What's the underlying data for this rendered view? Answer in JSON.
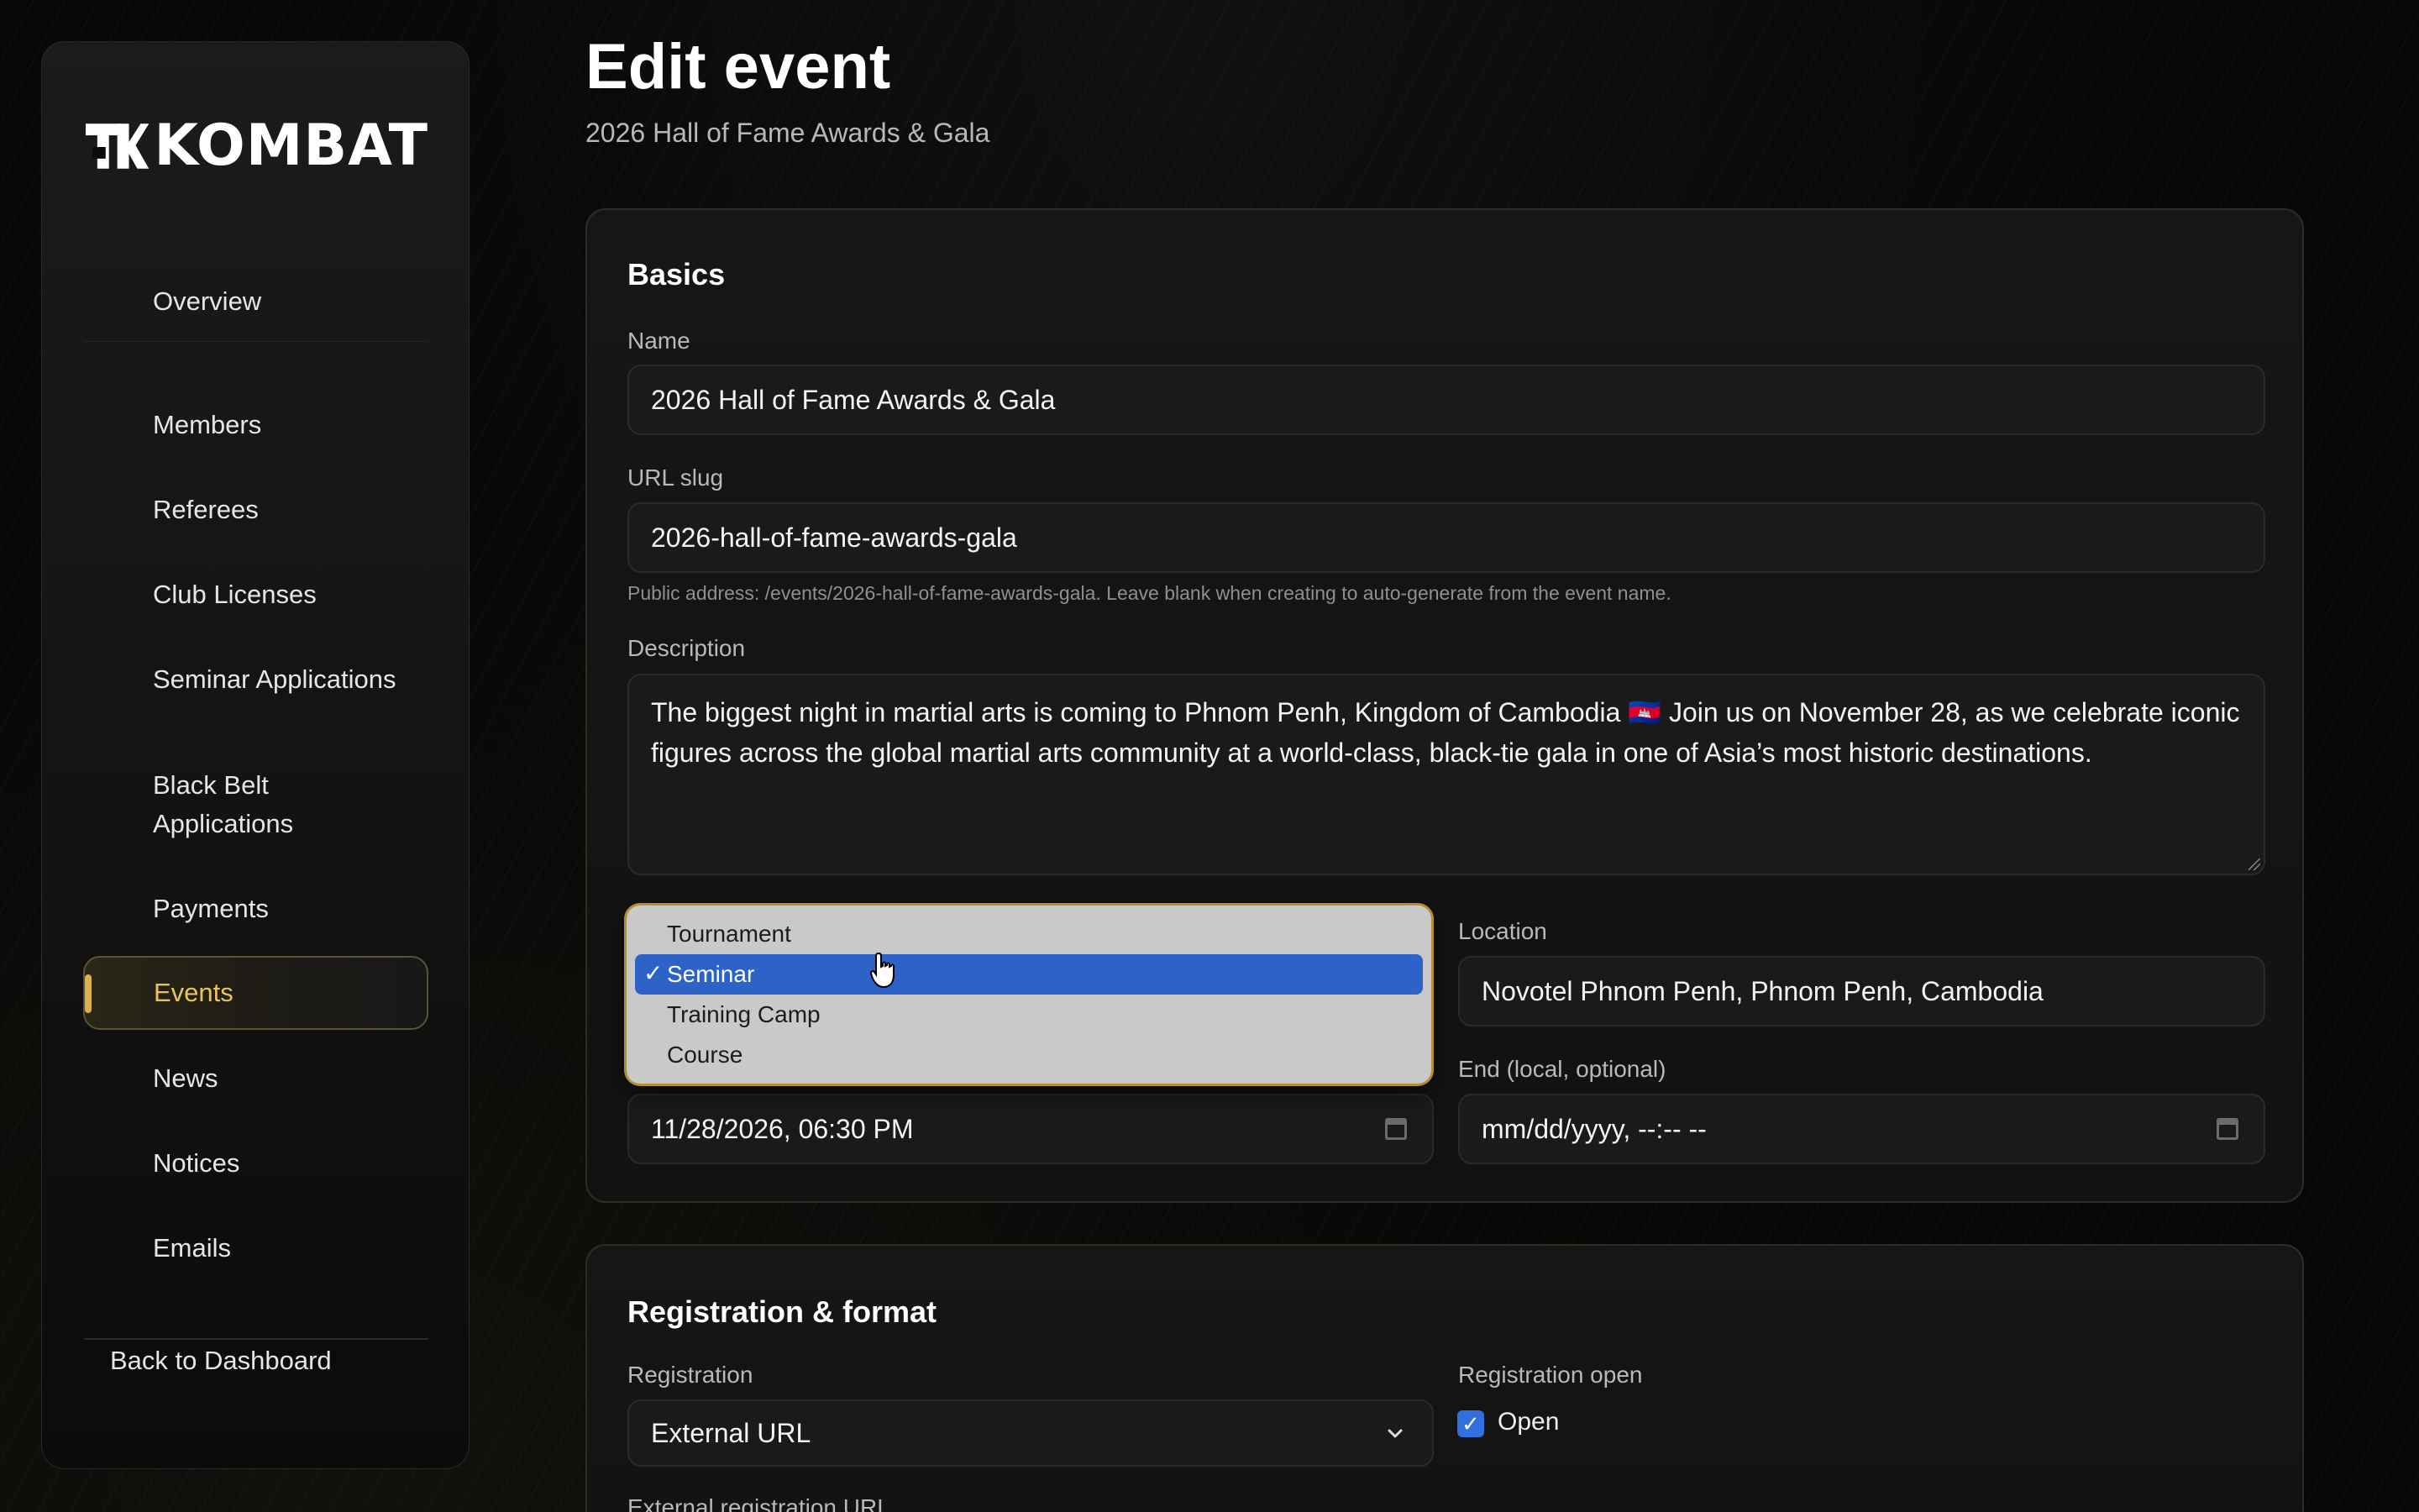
{
  "brand": {
    "name": "KOMBAT"
  },
  "sidebar": {
    "items": [
      {
        "label": "Overview"
      },
      {
        "label": "Members"
      },
      {
        "label": "Referees"
      },
      {
        "label": "Club Licenses"
      },
      {
        "label": "Seminar Applications"
      },
      {
        "label": "Black Belt Applications"
      },
      {
        "label": "Payments"
      },
      {
        "label": "Events",
        "active": true
      },
      {
        "label": "News"
      },
      {
        "label": "Notices"
      },
      {
        "label": "Emails"
      }
    ],
    "back_label": "Back to Dashboard"
  },
  "header": {
    "title": "Edit event",
    "subtitle": "2026 Hall of Fame Awards & Gala"
  },
  "basics": {
    "section_title": "Basics",
    "name_label": "Name",
    "name_value": "2026 Hall of Fame Awards & Gala",
    "slug_label": "URL slug",
    "slug_value": "2026-hall-of-fame-awards-gala",
    "slug_hint": "Public address: /events/2026-hall-of-fame-awards-gala. Leave blank when creating to auto-generate from the event name.",
    "description_label": "Description",
    "description_value": "The biggest night in martial arts is coming to Phnom Penh, Kingdom of Cambodia 🇰🇭 Join us on November 28, as we celebrate iconic figures across the global martial arts community at a world-class, black-tie gala in one of Asia’s most historic destinations.",
    "type_options": [
      "Tournament",
      "Seminar",
      "Training Camp",
      "Course"
    ],
    "type_selected": "Seminar",
    "location_label": "Location",
    "location_value": "Novotel Phnom Penh, Phnom Penh, Cambodia",
    "start_value": "11/28/2026, 06:30 PM",
    "end_label": "End (local, optional)",
    "end_placeholder": "mm/dd/yyyy, --:-- --"
  },
  "registration": {
    "section_title": "Registration & format",
    "registration_label": "Registration",
    "registration_value": "External URL",
    "open_label": "Registration open",
    "open_checkbox_label": "Open",
    "open_checked": true,
    "external_url_label": "External registration URL"
  },
  "colors": {
    "accent": "#e8c35a",
    "selected_option": "#2d63c8",
    "checkbox": "#2f6fe0"
  }
}
